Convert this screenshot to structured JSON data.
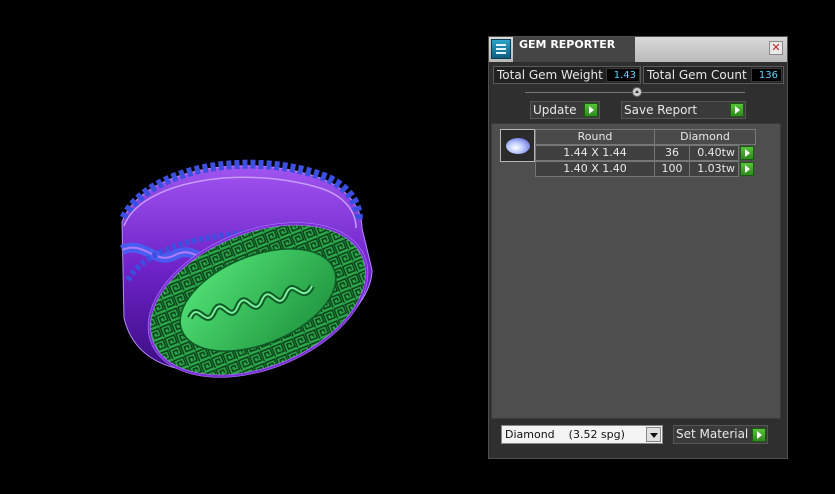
{
  "panel": {
    "title": "GEM REPORTER",
    "close_glyph": "✕",
    "icon": "gem-reporter-app-icon"
  },
  "stats": {
    "weight_label": "Total Gem Weight",
    "weight_value": "1.43",
    "count_label": "Total Gem Count",
    "count_value": "136"
  },
  "actions": {
    "update_label": "Update",
    "save_label": "Save Report"
  },
  "table": {
    "headers": [
      "Round",
      "Diamond"
    ],
    "rows": [
      {
        "size": "1.44 X 1.44",
        "count": "36",
        "weight": "0.40tw"
      },
      {
        "size": "1.40 X 1.40",
        "count": "100",
        "weight": "1.03tw"
      }
    ]
  },
  "material": {
    "selected": "Diamond    (3.52 spg)",
    "button_label": "Set Material"
  },
  "colors": {
    "accent_green": "#3fa52a",
    "value_text": "#5ad6ff",
    "ring_purple": "#7b2fd6",
    "ring_green": "#2fbf53",
    "ring_blue": "#3348d8"
  }
}
